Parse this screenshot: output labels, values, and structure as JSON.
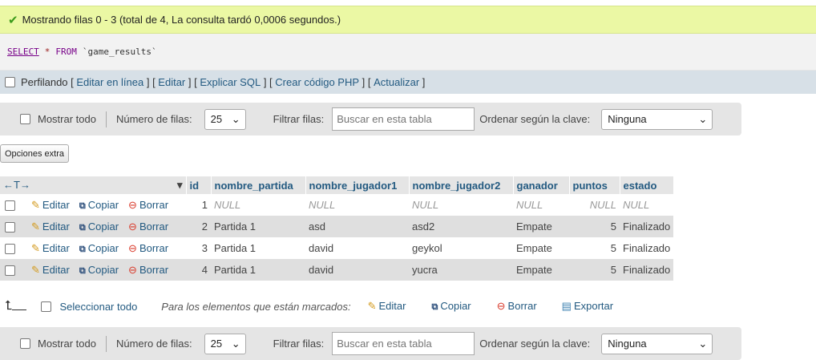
{
  "success": {
    "icon": "check-icon",
    "message": "Mostrando filas 0 - 3 (total de 4, La consulta tardó 0,0006 segundos.)"
  },
  "sql": {
    "keyword_select": "SELECT",
    "star": "*",
    "keyword_from": "FROM",
    "table": "`game_results`"
  },
  "profiling": {
    "label": "Perfilando",
    "links": [
      "Editar en línea",
      "Editar",
      "Explicar SQL",
      "Crear código PHP",
      "Actualizar"
    ]
  },
  "nav": {
    "show_all": "Mostrar todo",
    "rows_label": "Número de filas:",
    "rows_value": "25",
    "filter_label": "Filtrar filas:",
    "filter_placeholder": "Buscar en esta tabla",
    "sort_label": "Ordenar según la clave:",
    "sort_value": "Ninguna"
  },
  "extra_options": "Opciones extra",
  "table": {
    "nav_arrows": "←T→",
    "columns": [
      "id",
      "nombre_partida",
      "nombre_jugador1",
      "nombre_jugador2",
      "ganador",
      "puntos",
      "estado"
    ],
    "actions": {
      "edit": "Editar",
      "copy": "Copiar",
      "delete": "Borrar"
    },
    "rows": [
      [
        "1",
        "NULL",
        "NULL",
        "NULL",
        "NULL",
        "NULL",
        "NULL"
      ],
      [
        "2",
        "Partida 1",
        "asd",
        "asd2",
        "Empate",
        "5",
        "Finalizado"
      ],
      [
        "3",
        "Partida 1",
        "david",
        "geykol",
        "Empate",
        "5",
        "Finalizado"
      ],
      [
        "4",
        "Partida 1",
        "david",
        "yucra",
        "Empate",
        "5",
        "Finalizado"
      ]
    ]
  },
  "bottom": {
    "select_all": "Seleccionar todo",
    "with_selected": "Para los elementos que están marcados:",
    "edit": "Editar",
    "copy": "Copiar",
    "delete": "Borrar",
    "export": "Exportar"
  }
}
